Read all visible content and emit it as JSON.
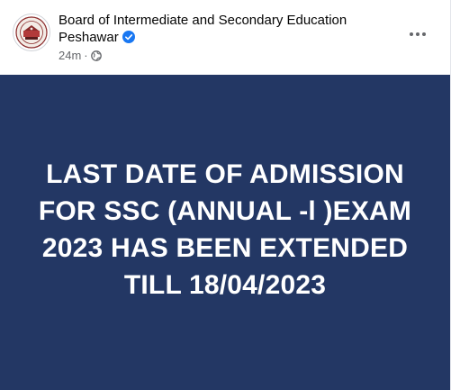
{
  "header": {
    "page_name": "Board of Intermediate and Secondary Education Peshawar",
    "timestamp": "24m",
    "separator": "·",
    "audience_icon": "globe-icon",
    "verified_icon": "verified-badge-icon",
    "more_icon": "more-options-icon"
  },
  "banner": {
    "announcement": "LAST DATE OF ADMISSION FOR SSC (ANNUAL -l )EXAM 2023 HAS BEEN EXTENDED TILL 18/04/2023",
    "background_color": "#233764",
    "text_color": "#ffffff"
  },
  "colors": {
    "verified_blue": "#1877f2",
    "secondary_text": "#65676b"
  }
}
